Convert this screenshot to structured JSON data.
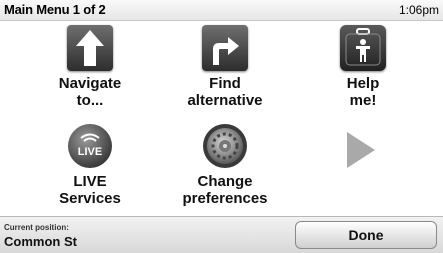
{
  "header": {
    "title": "Main Menu 1 of 2",
    "time": "1:06pm"
  },
  "menu": {
    "navigate_label": "Navigate\nto...",
    "find_alternative_label": "Find\nalternative",
    "help_label": "Help\nme!",
    "live_label": "LIVE\nServices",
    "live_badge": "LIVE",
    "preferences_label": "Change\npreferences"
  },
  "footer": {
    "current_position_label": "Current position:",
    "current_position_value": "Common St",
    "done_label": "Done"
  }
}
